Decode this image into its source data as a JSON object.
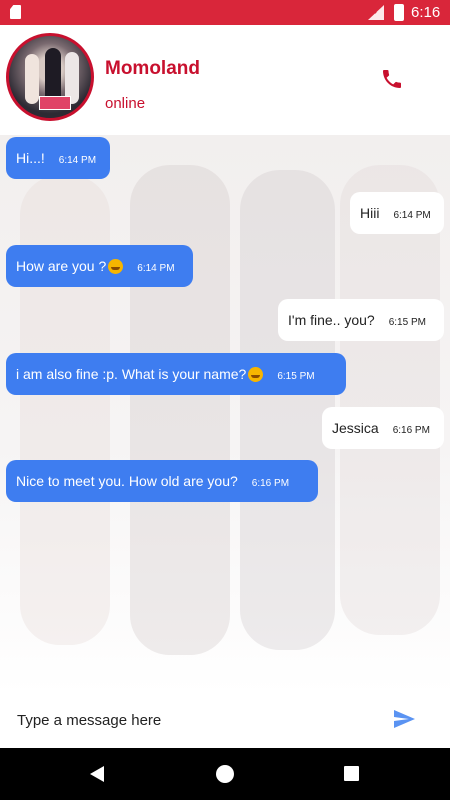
{
  "status_bar": {
    "time": "6:16",
    "icons": [
      "sd-card-icon",
      "signal-icon",
      "battery-icon"
    ]
  },
  "header": {
    "contact_name": "Momoland",
    "status": "online",
    "call_icon": "phone-icon"
  },
  "messages": [
    {
      "direction": "in",
      "text": "Hi...!",
      "time": "6:14 PM",
      "emoji": false
    },
    {
      "direction": "out",
      "text": "Hiii",
      "time": "6:14 PM",
      "emoji": false
    },
    {
      "direction": "in",
      "text": "How are you ?",
      "time": "6:14 PM",
      "emoji": true
    },
    {
      "direction": "out",
      "text": "I'm fine.. you?",
      "time": "6:15 PM",
      "emoji": false
    },
    {
      "direction": "in",
      "text": "i am also fine :p. What is your name?",
      "time": "6:15 PM",
      "emoji": true
    },
    {
      "direction": "out",
      "text": "Jessica",
      "time": "6:16 PM",
      "emoji": false
    },
    {
      "direction": "in",
      "text": "Nice to meet you. How old are you?",
      "time": "6:16 PM",
      "emoji": false
    }
  ],
  "composer": {
    "placeholder": "Type a message here",
    "send_icon": "send-icon"
  },
  "colors": {
    "brand": "#c8102e",
    "incoming_bubble": "#3e7df0",
    "outgoing_bubble": "#ffffff",
    "status_bar": "#d9263a"
  },
  "nav_bar": {
    "icons": [
      "back-icon",
      "home-icon",
      "recents-icon"
    ]
  }
}
